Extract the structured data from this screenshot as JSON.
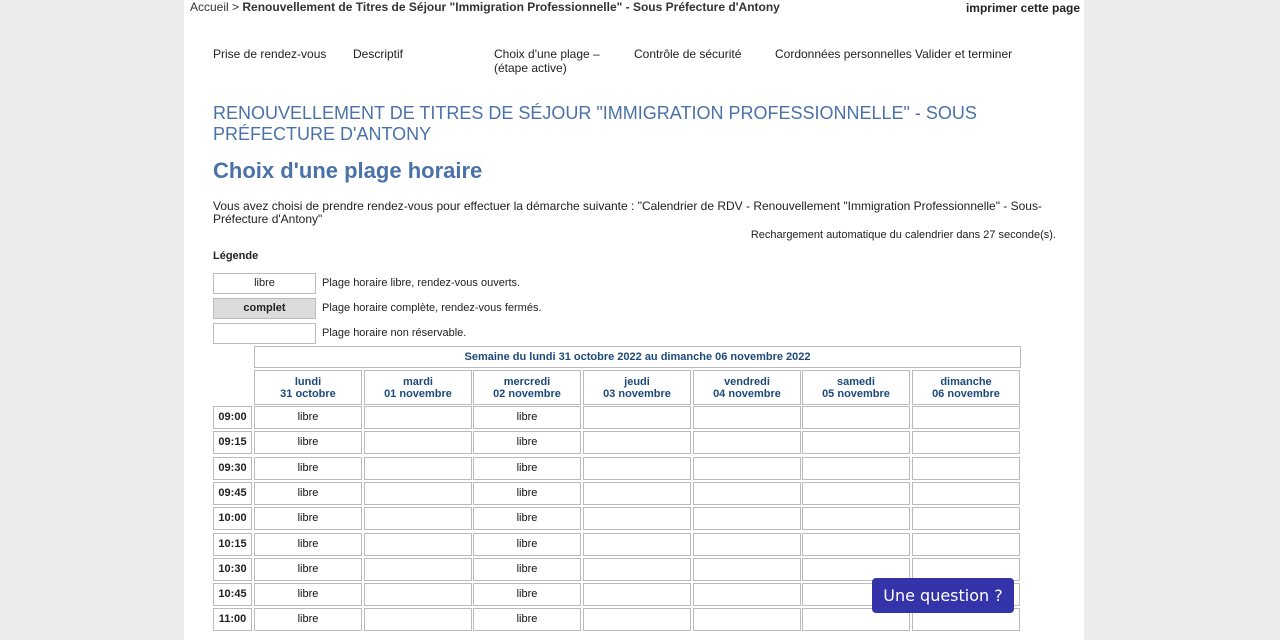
{
  "breadcrumb": {
    "home": "Accueil",
    "separator": ">",
    "current": "Renouvellement de Titres de Séjour \"Immigration Professionnelle\" - Sous Préfecture d'Antony"
  },
  "print_label": "imprimer cette page",
  "steps": [
    "Prise de rendez-vous",
    "Descriptif",
    "Choix d'une plage – (étape active)",
    "Contrôle de sécurité",
    "Cordonnées personnelles",
    "Valider et terminer"
  ],
  "title": "RENOUVELLEMENT DE TITRES DE SÉJOUR \"IMMIGRATION PROFESSIONNELLE\" - SOUS PRÉFECTURE D'ANTONY",
  "subtitle": "Choix d'une plage horaire",
  "intro": "Vous avez choisi de prendre rendez-vous pour effectuer la démarche suivante : \"Calendrier de RDV - Renouvellement \"Immigration Professionnelle\" - Sous-Préfecture d'Antony\"",
  "reload": "Rechargement automatique du calendrier dans 27   seconde(s).",
  "legend": {
    "title": "Légende",
    "items": [
      {
        "box": "libre",
        "text": "Plage horaire libre, rendez-vous ouverts."
      },
      {
        "box": "complet",
        "text": "Plage horaire complète, rendez-vous fermés."
      },
      {
        "box": "",
        "text": "Plage horaire non réservable."
      }
    ]
  },
  "calendar": {
    "week": "Semaine du lundi 31 octobre 2022 au dimanche 06 novembre 2022",
    "days": [
      {
        "name": "lundi",
        "date": "31 octobre"
      },
      {
        "name": "mardi",
        "date": "01 novembre"
      },
      {
        "name": "mercredi",
        "date": "02 novembre"
      },
      {
        "name": "jeudi",
        "date": "03 novembre"
      },
      {
        "name": "vendredi",
        "date": "04 novembre"
      },
      {
        "name": "samedi",
        "date": "05 novembre"
      },
      {
        "name": "dimanche",
        "date": "06 novembre"
      }
    ],
    "rows": [
      {
        "time": "09:00",
        "slots": [
          "libre",
          "",
          "libre",
          "",
          "",
          "",
          ""
        ]
      },
      {
        "time": "09:15",
        "slots": [
          "libre",
          "",
          "libre",
          "",
          "",
          "",
          ""
        ]
      },
      {
        "time": "09:30",
        "slots": [
          "libre",
          "",
          "libre",
          "",
          "",
          "",
          ""
        ]
      },
      {
        "time": "09:45",
        "slots": [
          "libre",
          "",
          "libre",
          "",
          "",
          "",
          ""
        ]
      },
      {
        "time": "10:00",
        "slots": [
          "libre",
          "",
          "libre",
          "",
          "",
          "",
          ""
        ]
      },
      {
        "time": "10:15",
        "slots": [
          "libre",
          "",
          "libre",
          "",
          "",
          "",
          ""
        ]
      },
      {
        "time": "10:30",
        "slots": [
          "libre",
          "",
          "libre",
          "",
          "",
          "",
          ""
        ]
      },
      {
        "time": "10:45",
        "slots": [
          "libre",
          "",
          "libre",
          "",
          "",
          "",
          ""
        ]
      },
      {
        "time": "11:00",
        "slots": [
          "libre",
          "",
          "libre",
          "",
          "",
          "",
          ""
        ]
      }
    ]
  },
  "help_button": "Une question ?"
}
